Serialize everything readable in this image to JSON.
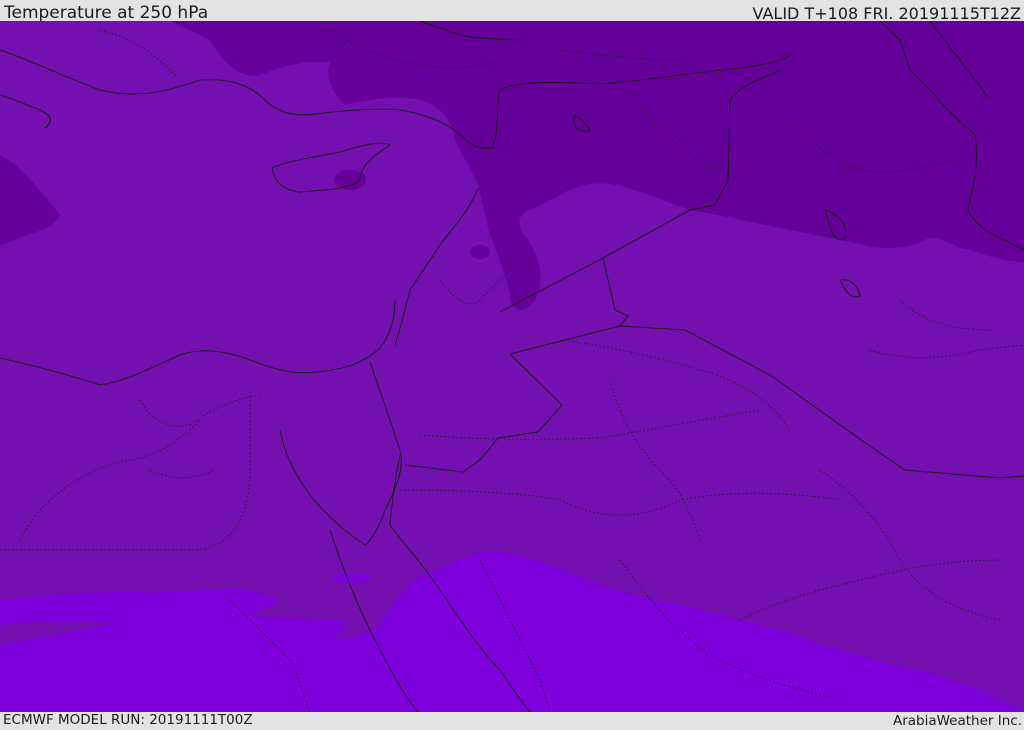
{
  "header": {
    "title": "Temperature at 250 hPa",
    "valid": "VALID T+108 FRI. 20191115T12Z"
  },
  "footer": {
    "model_run": "ECMWF MODEL RUN: 20191111T00Z",
    "credit": "ArabiaWeather Inc."
  },
  "map": {
    "region": "Eastern Mediterranean / Middle East",
    "field": "temperature",
    "level": "250 hPa",
    "colors": {
      "coldest": "#66009a",
      "cold": "#7510b0",
      "mid": "#7a0ec0",
      "warm": "#7e00dc",
      "border": "#1a1a1a"
    }
  }
}
